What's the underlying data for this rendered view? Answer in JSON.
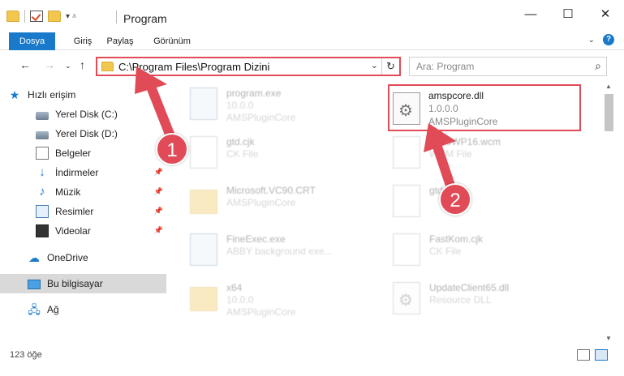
{
  "window": {
    "title": "Program"
  },
  "ribbon": {
    "tabs": [
      "Dosya",
      "Giriş",
      "Paylaş",
      "Görünüm"
    ]
  },
  "nav": {
    "address": "C:\\Program Files\\Program Dizini",
    "search_placeholder": "Ara: Program"
  },
  "sidebar": {
    "items": [
      {
        "label": "Hızlı erişim",
        "icon": "star-icon"
      },
      {
        "label": "Yerel Disk (C:)",
        "icon": "disk-icon"
      },
      {
        "label": "Yerel Disk (D:)",
        "icon": "disk-icon"
      },
      {
        "label": "Belgeler",
        "icon": "documents-icon"
      },
      {
        "label": "İndirmeler",
        "icon": "downloads-icon"
      },
      {
        "label": "Müzik",
        "icon": "music-icon"
      },
      {
        "label": "Resimler",
        "icon": "pictures-icon"
      },
      {
        "label": "Videolar",
        "icon": "videos-icon"
      },
      {
        "label": "OneDrive",
        "icon": "cloud-icon"
      },
      {
        "label": "Bu bilgisayar",
        "icon": "computer-icon"
      },
      {
        "label": "Ağ",
        "icon": "network-icon"
      }
    ]
  },
  "files": [
    {
      "name": "program.exe",
      "line2": "10.0.0",
      "line3": "AMSPluginCore"
    },
    {
      "name": "amspcore.dll",
      "line2": "1.0.0.0",
      "line3": "AMSPluginCore"
    },
    {
      "name": "gtd.cjk",
      "line2": "CK File",
      "line3": ""
    },
    {
      "name": "HelloWP16.wcm",
      "line2": "WCM File",
      "line3": ""
    },
    {
      "name": "Microsoft.VC90.CRT",
      "line2": "AMSPluginCore",
      "line3": ""
    },
    {
      "name": "gtd...",
      "line2": "",
      "line3": ""
    },
    {
      "name": "FineExec.exe",
      "line2": "ABBY background exe...",
      "line3": ""
    },
    {
      "name": "FastKom.cjk",
      "line2": "CK File",
      "line3": ""
    },
    {
      "name": "x64",
      "line2": "10.0.0",
      "line3": "AMSPluginCore"
    },
    {
      "name": "UpdateClient65.dll",
      "line2": "Resource DLL",
      "line3": ""
    }
  ],
  "status": {
    "count": "123 öğe"
  },
  "annotations": {
    "badge1": "1",
    "badge2": "2"
  },
  "colors": {
    "accent": "#1979ca",
    "highlight": "#e04b57"
  }
}
